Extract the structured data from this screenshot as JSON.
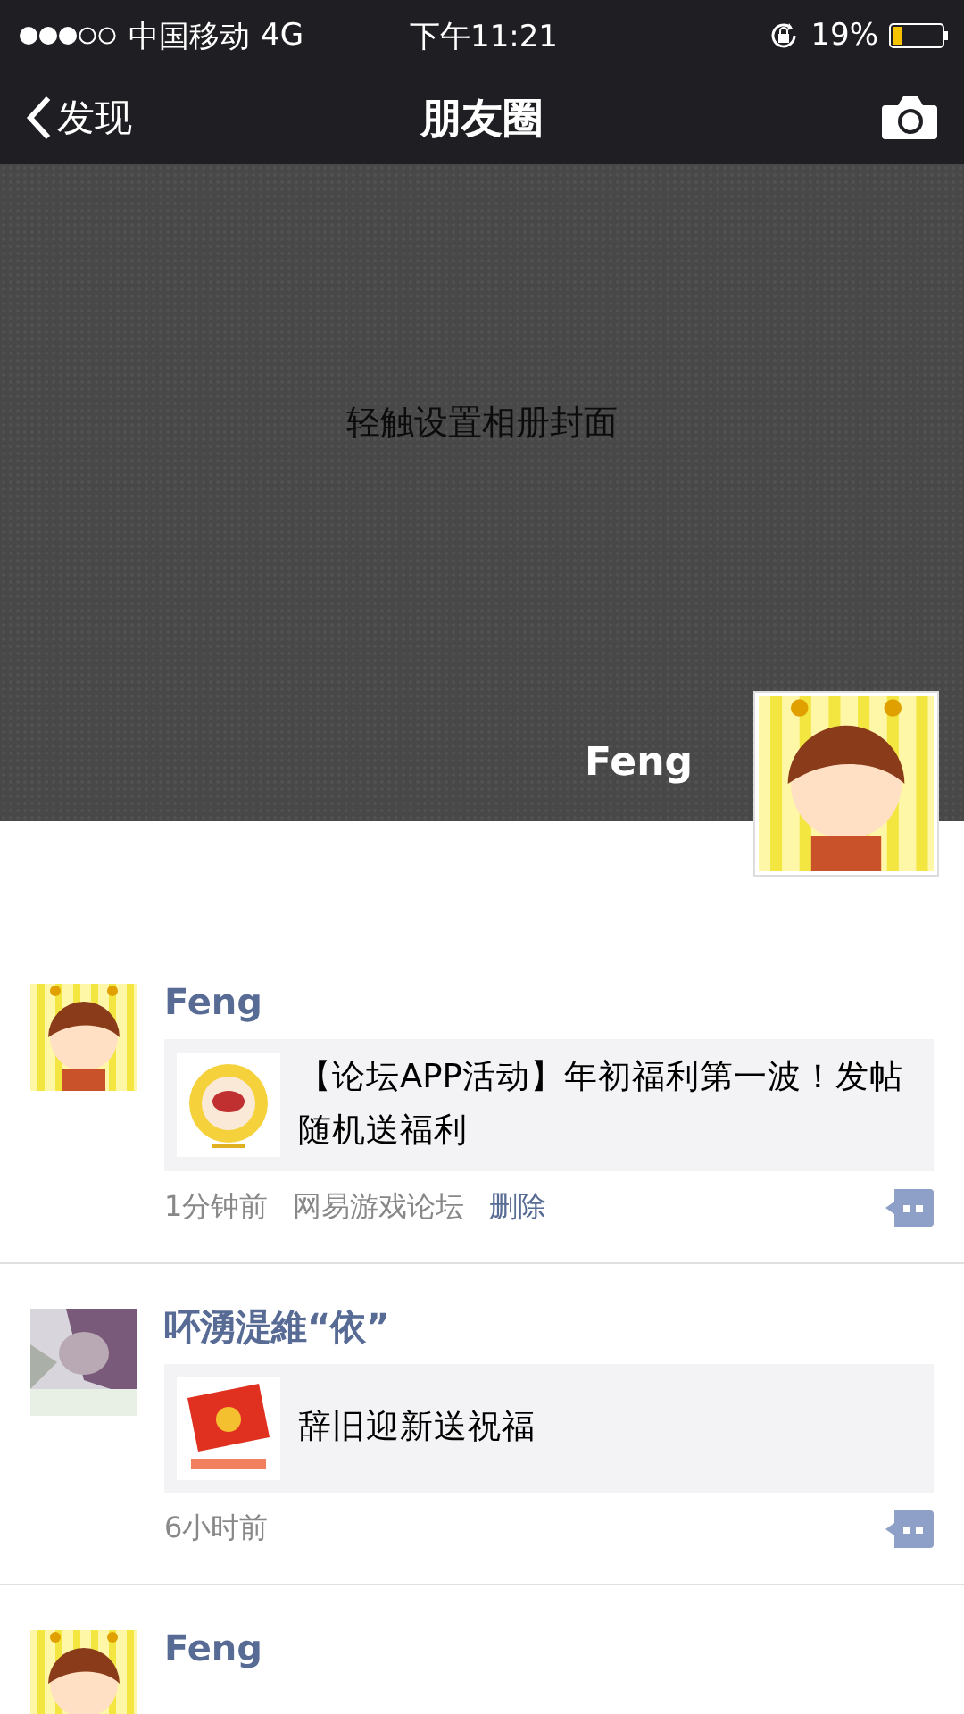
{
  "status_bar": {
    "carrier": "中国移动",
    "network": "4G",
    "time": "下午11:21",
    "battery": "19%"
  },
  "nav_bar": {
    "back": "发现",
    "title": "朋友圈"
  },
  "cover": {
    "hint": "轻触设置相册封面",
    "user_name": "Feng"
  },
  "posts": [
    {
      "author": "Feng",
      "link": {
        "title": "【论坛APP活动】年初福利第一波！发帖随机送福利"
      },
      "time": "1分钟前",
      "source": "网易游戏论坛",
      "delete": "删除"
    },
    {
      "author": "吥湧湜維“依”",
      "link": {
        "title": "辞旧迎新送祝福"
      },
      "time": "6小时前"
    },
    {
      "author": "Feng"
    }
  ]
}
